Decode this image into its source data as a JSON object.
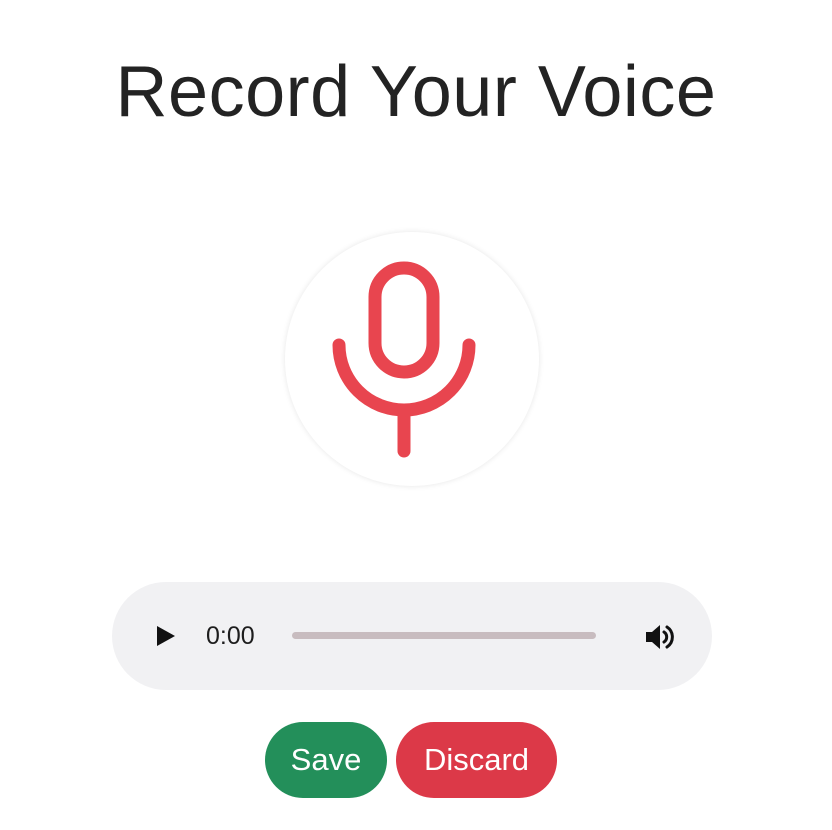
{
  "page": {
    "title": "Record Your Voice"
  },
  "recorder": {
    "icon": "microphone-icon",
    "accent_color": "#e8454f"
  },
  "player": {
    "play_icon": "play-icon",
    "time": "0:00",
    "progress": 0,
    "volume_icon": "volume-icon"
  },
  "actions": {
    "save_label": "Save",
    "save_color": "#238f5a",
    "discard_label": "Discard",
    "discard_color": "#dc3948"
  }
}
